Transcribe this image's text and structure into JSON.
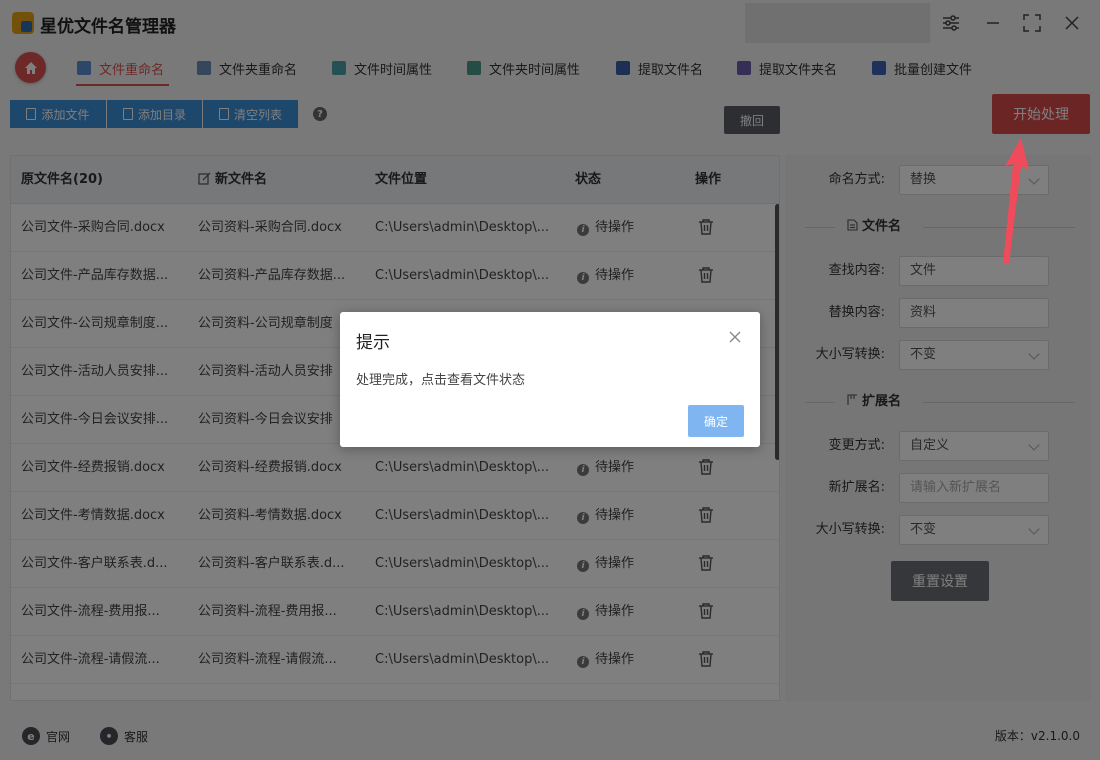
{
  "app": {
    "title": "星优文件名管理器"
  },
  "tabs": [
    {
      "label": "文件重命名",
      "active": true
    },
    {
      "label": "文件夹重命名"
    },
    {
      "label": "文件时间属性"
    },
    {
      "label": "文件夹时间属性"
    },
    {
      "label": "提取文件名"
    },
    {
      "label": "提取文件夹名"
    },
    {
      "label": "批量创建文件"
    }
  ],
  "toolbar": {
    "add_file": "添加文件",
    "add_dir": "添加目录",
    "clear_list": "清空列表",
    "undo": "撤回",
    "start": "开始处理"
  },
  "table": {
    "headers": {
      "original": "原文件名(20)",
      "new": "新文件名",
      "location": "文件位置",
      "status": "状态",
      "action": "操作"
    },
    "rows": [
      {
        "original": "公司文件-采购合同.docx",
        "new": "公司资料-采购合同.docx",
        "location": "C:\\Users\\admin\\Desktop\\...",
        "status": "待操作"
      },
      {
        "original": "公司文件-产品库存数据...",
        "new": "公司资料-产品库存数据...",
        "location": "C:\\Users\\admin\\Desktop\\...",
        "status": "待操作"
      },
      {
        "original": "公司文件-公司规章制度...",
        "new": "公司资料-公司规章制度",
        "location": "",
        "status": ""
      },
      {
        "original": "公司文件-活动人员安排...",
        "new": "公司资料-活动人员安排",
        "location": "",
        "status": ""
      },
      {
        "original": "公司文件-今日会议安排...",
        "new": "公司资料-今日会议安排",
        "location": "",
        "status": ""
      },
      {
        "original": "公司文件-经费报销.docx",
        "new": "公司资料-经费报销.docx",
        "location": "C:\\Users\\admin\\Desktop\\...",
        "status": "待操作"
      },
      {
        "original": "公司文件-考情数据.docx",
        "new": "公司资料-考情数据.docx",
        "location": "C:\\Users\\admin\\Desktop\\...",
        "status": "待操作"
      },
      {
        "original": "公司文件-客户联系表.d...",
        "new": "公司资料-客户联系表.d...",
        "location": "C:\\Users\\admin\\Desktop\\...",
        "status": "待操作"
      },
      {
        "original": "公司文件-流程-费用报...",
        "new": "公司资料-流程-费用报...",
        "location": "C:\\Users\\admin\\Desktop\\...",
        "status": "待操作"
      },
      {
        "original": "公司文件-流程-请假流...",
        "new": "公司资料-流程-请假流...",
        "location": "C:\\Users\\admin\\Desktop\\...",
        "status": "待操作"
      }
    ]
  },
  "panel": {
    "naming_label": "命名方式:",
    "naming_value": "替换",
    "section_filename": "文件名",
    "find_label": "查找内容:",
    "find_value": "文件",
    "replace_label": "替换内容:",
    "replace_value": "资料",
    "case_label": "大小写转换:",
    "case_value": "不变",
    "section_ext": "扩展名",
    "change_label": "变更方式:",
    "change_value": "自定义",
    "newext_label": "新扩展名:",
    "newext_placeholder": "请输入新扩展名",
    "case2_label": "大小写转换:",
    "case2_value": "不变",
    "reset": "重置设置"
  },
  "footer": {
    "website": "官网",
    "service": "客服",
    "version": "版本：v2.1.0.0"
  },
  "dialog": {
    "title": "提示",
    "message": "处理完成，点击查看文件状态",
    "ok": "确定"
  },
  "colors": {
    "accent_red": "#d94a4a",
    "accent_blue": "#3c8fd9"
  }
}
